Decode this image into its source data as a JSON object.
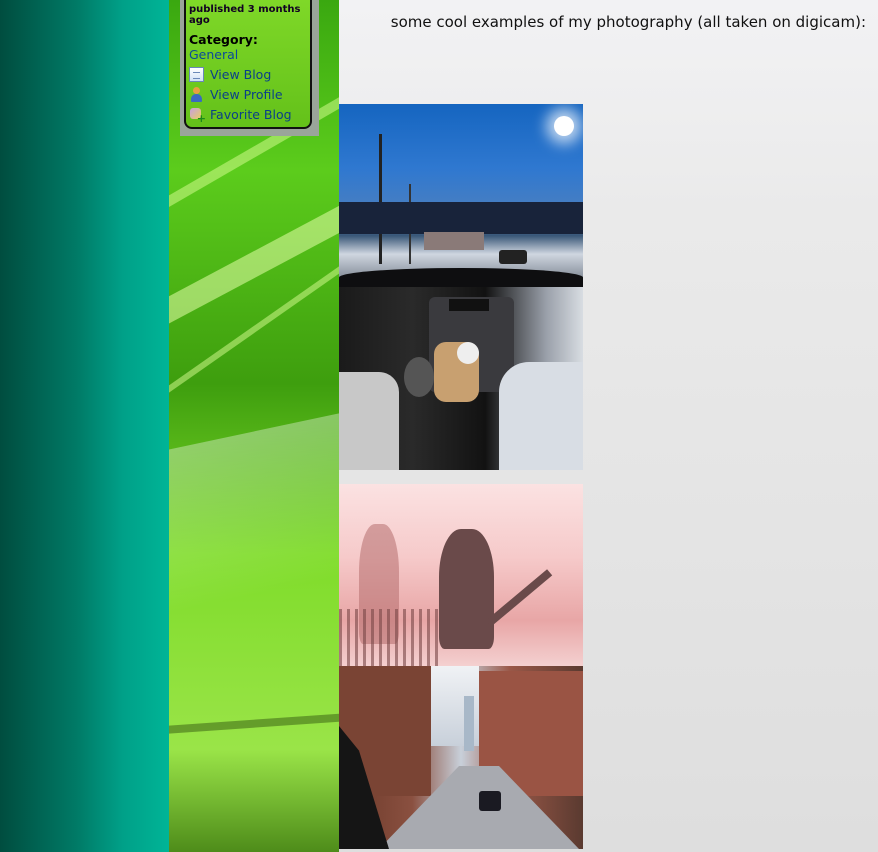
{
  "blog": {
    "published": "published 3 months ago",
    "category_label": "Category:",
    "category_value": "General",
    "actions": [
      {
        "label": "View Blog",
        "icon": "page-icon"
      },
      {
        "label": "View Profile",
        "icon": "user-icon"
      },
      {
        "label": "Favorite Blog",
        "icon": "favorite-add-icon"
      }
    ]
  },
  "content": {
    "intro": "some cool examples of my photography (all taken on digicam):"
  },
  "colors": {
    "left_teal": "#007a66",
    "widget_green": "#7fd828",
    "link_blue": "#0a4a9a"
  }
}
